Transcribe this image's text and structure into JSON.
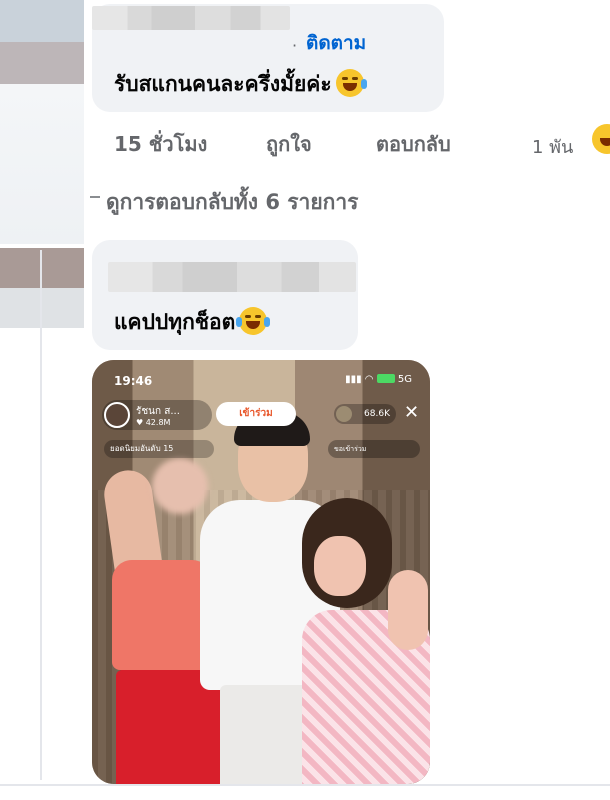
{
  "comment1": {
    "author": "",
    "separator": "·",
    "follow_label": "ติดตาม",
    "text": "รับสแกนคนละครึ่งมั้ยค่ะ",
    "emoji": "rolling-on-floor-laughing-emoji"
  },
  "actions": {
    "time": "15 ชั่วโมง",
    "like": "ถูกใจ",
    "reply": "ตอบกลับ",
    "reaction_count": "1 พัน"
  },
  "view_replies": "ดูการตอบกลับทั้ง 6 รายการ",
  "comment2": {
    "author": "",
    "text": "แคปปทุกช็อต",
    "emoji": "tears-of-joy-emoji"
  },
  "media": {
    "status_time": "19:46",
    "network": "5G",
    "host_name": "รัชนก ส...",
    "host_likes": "♥ 42.8M",
    "join_label": "เข้าร่วม",
    "viewer_count": "68.6K",
    "close_label": "✕",
    "rank_label": "ยอดนิยมอันดับ 15",
    "request_label": "ขอเข้าร่วม"
  }
}
